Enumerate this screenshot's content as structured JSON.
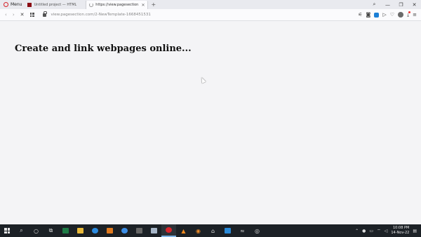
{
  "tabs": {
    "menu_label": "Menu",
    "tab1_label": "Untitled project — HTML",
    "tab2_label": "https://view.pagesection.c",
    "new_tab": "+"
  },
  "window_controls": {
    "search": "⌕",
    "minimize": "—",
    "restore": "❐",
    "close": "✕"
  },
  "address": {
    "url_host": "view.pagesection.com",
    "url_path": "/2-NewTemplate-1668451531"
  },
  "page": {
    "heading": "Create and link webpages online..."
  },
  "taskbar": {
    "time": "10:08 PM",
    "date": "14-Nov-22"
  },
  "colors": {
    "opera_red": "#d8232a",
    "taskbar_bg": "#1c2126",
    "page_bg": "#f4f4f6"
  }
}
